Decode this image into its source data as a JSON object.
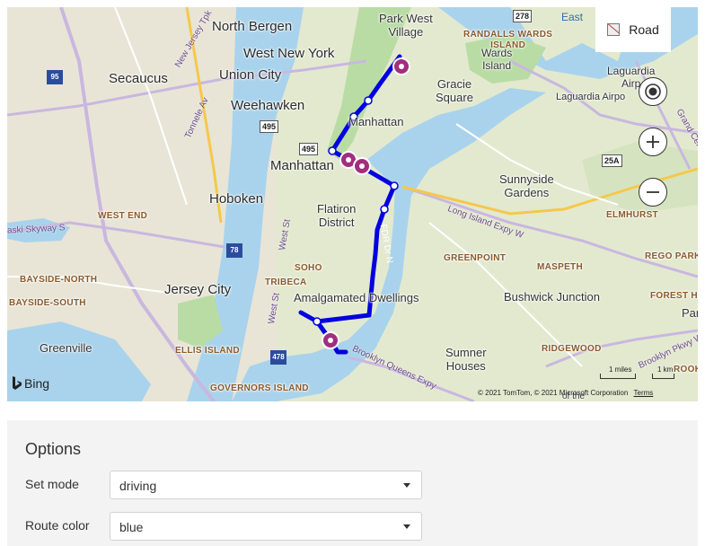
{
  "map": {
    "style_button_label": "Road",
    "route_color": "#0000e0",
    "pin_color": "#a22e7e",
    "attribution": "© 2021 TomTom, © 2021 Microsoft Corporation",
    "terms_label": "Terms",
    "brand": "Bing",
    "scale": {
      "miles": "1 miles",
      "km": "1 km"
    },
    "labels": {
      "north_bergen": "North Bergen",
      "west_new_york": "West New York",
      "union_city": "Union City",
      "secaucus": "Secaucus",
      "weehawken": "Weehawken",
      "manhattan_small": "Manhattan",
      "manhattan": "Manhattan",
      "hoboken": "Hoboken",
      "flatiron": "Flatiron\nDistrict",
      "jersey_city": "Jersey City",
      "amalgamated": "Amalgamated Dwellings",
      "greenville": "Greenville",
      "park_west": "Park West\nVillage",
      "gracie": "Gracie\nSquare",
      "randalls": "RANDALLS WARDS\nISLAND",
      "wards": "Wards\nIsland",
      "laguardia": "Laguardia\nAirp",
      "laguardia_airport": "Laguardia Airpo",
      "east": "East",
      "sunnyside": "Sunnyside\nGardens",
      "elmhurst": "ELMHURST",
      "rego_park": "REGO PARK",
      "maspeth": "MASPETH",
      "greenpoint": "GREENPOINT",
      "bushwick": "Bushwick Junction",
      "forest_hi": "FOREST HI",
      "par": "Par",
      "ridgewood": "RIDGEWOOD",
      "sumner": "Sumner\nHouses",
      "west_end": "WEST END",
      "bayside_north": "BAYSIDE-NORTH",
      "bayside_south": "BAYSIDE-SOUTH",
      "soho": "SOHO",
      "tribeca": "TRIBECA",
      "ellis": "ELLIS ISLAND",
      "governors": "GOVERNORS ISLAND",
      "skyway": "aski Skyway S",
      "new_jersey_tpk": "New Jersey Tpk",
      "tonnele": "Tonnele Av",
      "west_st": "West St",
      "west_st2": "West St",
      "long_island_expy": "Long Island Expy W",
      "fdr": "FDR Dr N",
      "brooklyn_queens": "Brooklyn Queens Expy",
      "grand_central": "Grand Cen",
      "brooklyn_pkwy": "Brooklyn Pkwy W",
      "of_the": "of the",
      "rook": "ROOK"
    },
    "shields": {
      "s278": "278",
      "s95": "95",
      "s495a": "495",
      "s495b": "495",
      "s78": "78",
      "s478": "478",
      "s25a": "25A"
    }
  },
  "options": {
    "title": "Options",
    "mode_label": "Set mode",
    "mode_value": "driving",
    "color_label": "Route color",
    "color_value": "blue"
  }
}
